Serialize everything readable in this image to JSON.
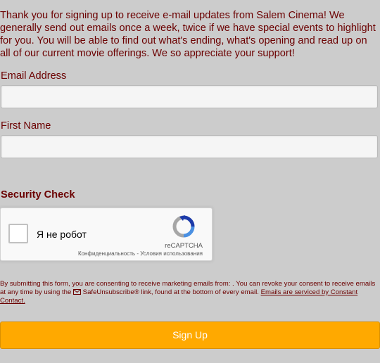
{
  "intro": {
    "text": "Thank you for signing up to receive e-mail updates from Salem Cinema! We generally send out emails once a week, twice if we have special events to highlight for you. You will be able to find out what's ending, what's opening and read up on all of our current movie offerings. We so appreciate your support!"
  },
  "form": {
    "email_label": "Email Address",
    "email_value": "",
    "first_name_label": "First Name",
    "first_name_value": "",
    "security_title": "Security Check"
  },
  "captcha": {
    "checkbox_label": "Я не робот",
    "brand": "reCAPTCHA",
    "privacy_link": "Конфиденциальность",
    "separator": " - ",
    "terms_link": "Условия использования",
    "checked": false,
    "icon": "recaptcha-logo-icon"
  },
  "consent": {
    "text_1": "By submitting this form, you are consenting to receive marketing emails from: . You can revoke your consent to receive emails at any time by using the ",
    "safeunsubscribe": "SafeUnsubscribe®",
    "text_2": " link, found at the bottom of every email. ",
    "cc_link": "Emails are serviced by Constant Contact.",
    "icon": "envelope-icon"
  },
  "signup_button": {
    "label": "Sign Up"
  },
  "colors": {
    "background": "#cccccc",
    "text": "#6b0000",
    "button": "#ffa900",
    "button_text": "#ffffff"
  }
}
